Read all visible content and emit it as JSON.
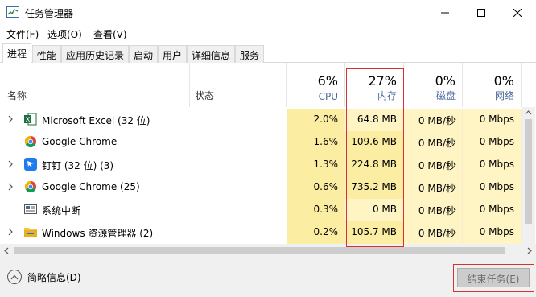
{
  "window": {
    "title": "任务管理器",
    "controls": {
      "minimize": "—",
      "maximize": "☐",
      "close": "✕"
    }
  },
  "menu": {
    "items": [
      "文件(F)",
      "选项(O)",
      "查看(V)"
    ]
  },
  "tabs": [
    {
      "label": "进程",
      "active": true
    },
    {
      "label": "性能",
      "active": false
    },
    {
      "label": "应用历史记录",
      "active": false
    },
    {
      "label": "启动",
      "active": false
    },
    {
      "label": "用户",
      "active": false
    },
    {
      "label": "详细信息",
      "active": false
    },
    {
      "label": "服务",
      "active": false
    }
  ],
  "columns": {
    "name": "名称",
    "status": "状态",
    "cpu": {
      "percent": "6%",
      "label": "CPU"
    },
    "memory": {
      "percent": "27%",
      "label": "内存"
    },
    "disk": {
      "percent": "0%",
      "label": "磁盘"
    },
    "network": {
      "percent": "0%",
      "label": "网络"
    }
  },
  "processes": [
    {
      "name": "Microsoft Excel (32 位)",
      "icon": "excel-icon",
      "expandable": true,
      "cpu": "2.0%",
      "memory": "64.8 MB",
      "disk": "0 MB/秒",
      "network": "0 Mbps"
    },
    {
      "name": "Google Chrome",
      "icon": "chrome-icon",
      "expandable": false,
      "cpu": "1.6%",
      "memory": "109.6 MB",
      "disk": "0 MB/秒",
      "network": "0 Mbps"
    },
    {
      "name": "钉钉 (32 位) (3)",
      "icon": "dingtalk-icon",
      "expandable": true,
      "cpu": "1.3%",
      "memory": "224.8 MB",
      "disk": "0 MB/秒",
      "network": "0 Mbps"
    },
    {
      "name": "Google Chrome (25)",
      "icon": "chrome-icon",
      "expandable": true,
      "cpu": "0.6%",
      "memory": "735.2 MB",
      "disk": "0 MB/秒",
      "network": "0 Mbps"
    },
    {
      "name": "系统中断",
      "icon": "system-interrupts-icon",
      "expandable": false,
      "cpu": "0.3%",
      "memory": "0 MB",
      "disk": "0 MB/秒",
      "network": "0 Mbps"
    },
    {
      "name": "Windows 资源管理器 (2)",
      "icon": "folder-icon",
      "expandable": true,
      "cpu": "0.2%",
      "memory": "105.7 MB",
      "disk": "0 MB/秒",
      "network": "0 Mbps"
    }
  ],
  "footer": {
    "fewer_details": "简略信息(D)",
    "end_task": "结束任务(E)"
  },
  "colors": {
    "heat_high": "#fbeda1",
    "heat_low": "#fff4c4",
    "highlight_outline": "#d9312f",
    "column_label": "#4c6a9b"
  }
}
